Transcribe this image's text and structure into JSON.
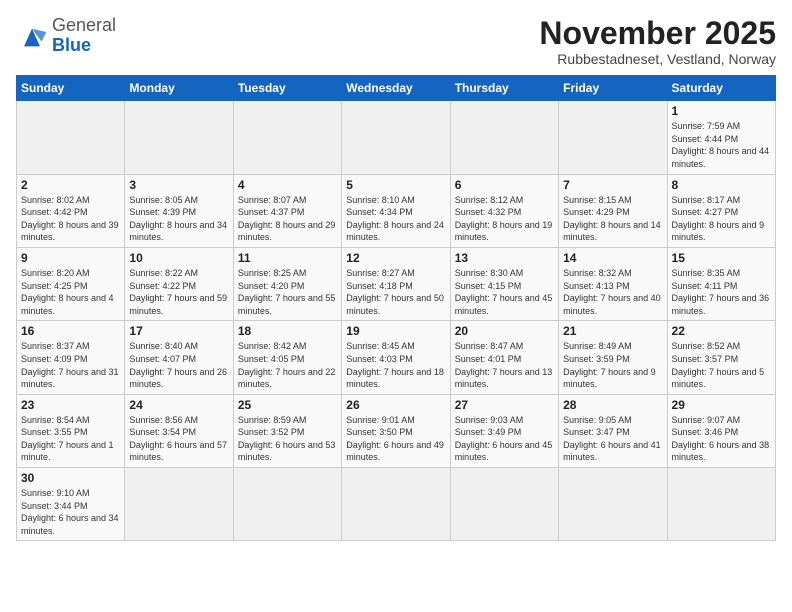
{
  "logo": {
    "general": "General",
    "blue": "Blue"
  },
  "header": {
    "month": "November 2025",
    "location": "Rubbestadneset, Vestland, Norway"
  },
  "weekdays": [
    "Sunday",
    "Monday",
    "Tuesday",
    "Wednesday",
    "Thursday",
    "Friday",
    "Saturday"
  ],
  "weeks": [
    [
      {
        "day": "",
        "info": ""
      },
      {
        "day": "",
        "info": ""
      },
      {
        "day": "",
        "info": ""
      },
      {
        "day": "",
        "info": ""
      },
      {
        "day": "",
        "info": ""
      },
      {
        "day": "",
        "info": ""
      },
      {
        "day": "1",
        "info": "Sunrise: 7:59 AM\nSunset: 4:44 PM\nDaylight: 8 hours\nand 44 minutes."
      }
    ],
    [
      {
        "day": "2",
        "info": "Sunrise: 8:02 AM\nSunset: 4:42 PM\nDaylight: 8 hours\nand 39 minutes."
      },
      {
        "day": "3",
        "info": "Sunrise: 8:05 AM\nSunset: 4:39 PM\nDaylight: 8 hours\nand 34 minutes."
      },
      {
        "day": "4",
        "info": "Sunrise: 8:07 AM\nSunset: 4:37 PM\nDaylight: 8 hours\nand 29 minutes."
      },
      {
        "day": "5",
        "info": "Sunrise: 8:10 AM\nSunset: 4:34 PM\nDaylight: 8 hours\nand 24 minutes."
      },
      {
        "day": "6",
        "info": "Sunrise: 8:12 AM\nSunset: 4:32 PM\nDaylight: 8 hours\nand 19 minutes."
      },
      {
        "day": "7",
        "info": "Sunrise: 8:15 AM\nSunset: 4:29 PM\nDaylight: 8 hours\nand 14 minutes."
      },
      {
        "day": "8",
        "info": "Sunrise: 8:17 AM\nSunset: 4:27 PM\nDaylight: 8 hours\nand 9 minutes."
      }
    ],
    [
      {
        "day": "9",
        "info": "Sunrise: 8:20 AM\nSunset: 4:25 PM\nDaylight: 8 hours\nand 4 minutes."
      },
      {
        "day": "10",
        "info": "Sunrise: 8:22 AM\nSunset: 4:22 PM\nDaylight: 7 hours\nand 59 minutes."
      },
      {
        "day": "11",
        "info": "Sunrise: 8:25 AM\nSunset: 4:20 PM\nDaylight: 7 hours\nand 55 minutes."
      },
      {
        "day": "12",
        "info": "Sunrise: 8:27 AM\nSunset: 4:18 PM\nDaylight: 7 hours\nand 50 minutes."
      },
      {
        "day": "13",
        "info": "Sunrise: 8:30 AM\nSunset: 4:15 PM\nDaylight: 7 hours\nand 45 minutes."
      },
      {
        "day": "14",
        "info": "Sunrise: 8:32 AM\nSunset: 4:13 PM\nDaylight: 7 hours\nand 40 minutes."
      },
      {
        "day": "15",
        "info": "Sunrise: 8:35 AM\nSunset: 4:11 PM\nDaylight: 7 hours\nand 36 minutes."
      }
    ],
    [
      {
        "day": "16",
        "info": "Sunrise: 8:37 AM\nSunset: 4:09 PM\nDaylight: 7 hours\nand 31 minutes."
      },
      {
        "day": "17",
        "info": "Sunrise: 8:40 AM\nSunset: 4:07 PM\nDaylight: 7 hours\nand 26 minutes."
      },
      {
        "day": "18",
        "info": "Sunrise: 8:42 AM\nSunset: 4:05 PM\nDaylight: 7 hours\nand 22 minutes."
      },
      {
        "day": "19",
        "info": "Sunrise: 8:45 AM\nSunset: 4:03 PM\nDaylight: 7 hours\nand 18 minutes."
      },
      {
        "day": "20",
        "info": "Sunrise: 8:47 AM\nSunset: 4:01 PM\nDaylight: 7 hours\nand 13 minutes."
      },
      {
        "day": "21",
        "info": "Sunrise: 8:49 AM\nSunset: 3:59 PM\nDaylight: 7 hours\nand 9 minutes."
      },
      {
        "day": "22",
        "info": "Sunrise: 8:52 AM\nSunset: 3:57 PM\nDaylight: 7 hours\nand 5 minutes."
      }
    ],
    [
      {
        "day": "23",
        "info": "Sunrise: 8:54 AM\nSunset: 3:55 PM\nDaylight: 7 hours\nand 1 minute."
      },
      {
        "day": "24",
        "info": "Sunrise: 8:56 AM\nSunset: 3:54 PM\nDaylight: 6 hours\nand 57 minutes."
      },
      {
        "day": "25",
        "info": "Sunrise: 8:59 AM\nSunset: 3:52 PM\nDaylight: 6 hours\nand 53 minutes."
      },
      {
        "day": "26",
        "info": "Sunrise: 9:01 AM\nSunset: 3:50 PM\nDaylight: 6 hours\nand 49 minutes."
      },
      {
        "day": "27",
        "info": "Sunrise: 9:03 AM\nSunset: 3:49 PM\nDaylight: 6 hours\nand 45 minutes."
      },
      {
        "day": "28",
        "info": "Sunrise: 9:05 AM\nSunset: 3:47 PM\nDaylight: 6 hours\nand 41 minutes."
      },
      {
        "day": "29",
        "info": "Sunrise: 9:07 AM\nSunset: 3:46 PM\nDaylight: 6 hours\nand 38 minutes."
      }
    ],
    [
      {
        "day": "30",
        "info": "Sunrise: 9:10 AM\nSunset: 3:44 PM\nDaylight: 6 hours\nand 34 minutes."
      },
      {
        "day": "",
        "info": ""
      },
      {
        "day": "",
        "info": ""
      },
      {
        "day": "",
        "info": ""
      },
      {
        "day": "",
        "info": ""
      },
      {
        "day": "",
        "info": ""
      },
      {
        "day": "",
        "info": ""
      }
    ]
  ]
}
